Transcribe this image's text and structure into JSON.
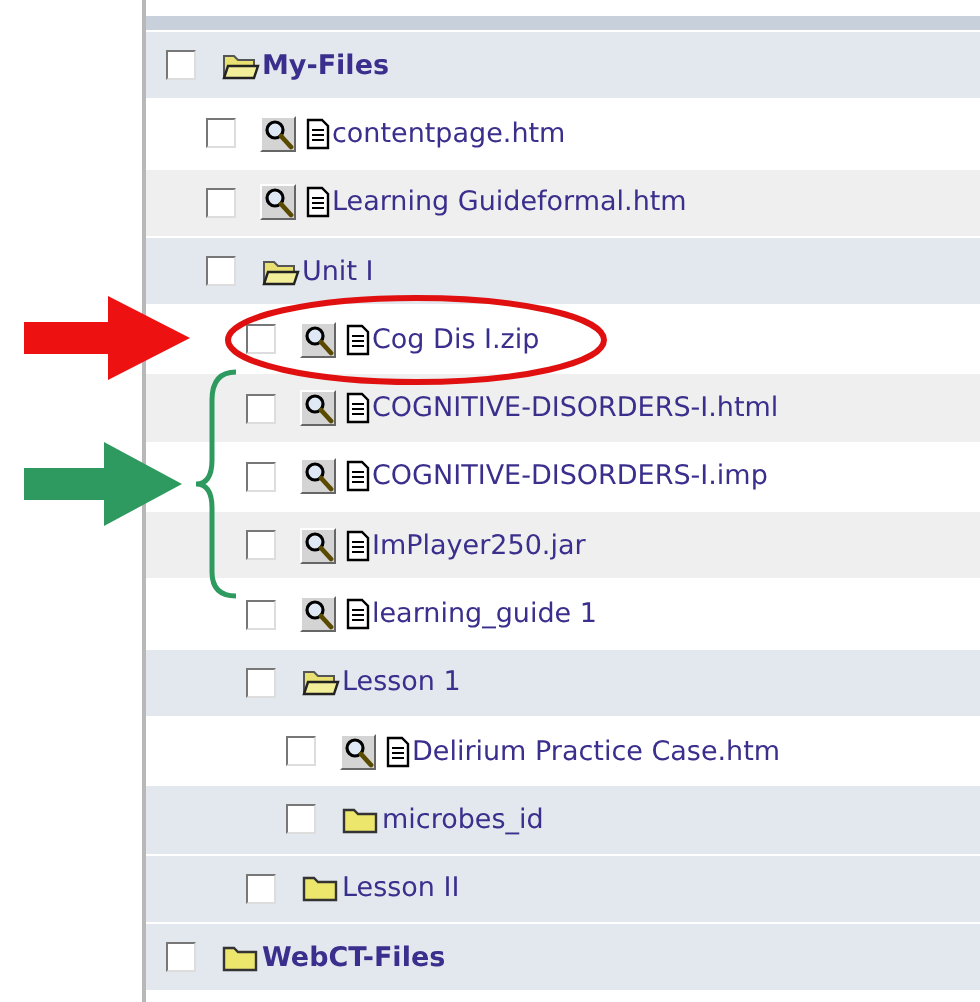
{
  "tree": [
    {
      "kind": "folder",
      "name": "My-Files",
      "checked": false,
      "expanded": true,
      "children": [
        {
          "kind": "file",
          "name": "contentpage.htm",
          "checked": false
        },
        {
          "kind": "file",
          "name": "Learning Guideformal.htm",
          "checked": false
        },
        {
          "kind": "folder",
          "name": "Unit I",
          "checked": false,
          "expanded": true,
          "children": [
            {
              "kind": "file",
              "name": "Cog Dis I.zip",
              "checked": false
            },
            {
              "kind": "file",
              "name": "COGNITIVE-DISORDERS-I.html",
              "checked": false
            },
            {
              "kind": "file",
              "name": "COGNITIVE-DISORDERS-I.imp",
              "checked": false
            },
            {
              "kind": "file",
              "name": "ImPlayer250.jar",
              "checked": false
            },
            {
              "kind": "file",
              "name": "learning_guide 1",
              "checked": false
            },
            {
              "kind": "folder",
              "name": "Lesson 1",
              "checked": false,
              "expanded": true,
              "children": [
                {
                  "kind": "file",
                  "name": "Delirium Practice Case.htm",
                  "checked": false
                },
                {
                  "kind": "folder",
                  "name": "microbes_id",
                  "checked": false,
                  "expanded": false
                }
              ]
            },
            {
              "kind": "folder",
              "name": "Lesson II",
              "checked": false,
              "expanded": false
            }
          ]
        }
      ]
    },
    {
      "kind": "folder",
      "name": "WebCT-Files",
      "checked": false,
      "expanded": false
    }
  ]
}
